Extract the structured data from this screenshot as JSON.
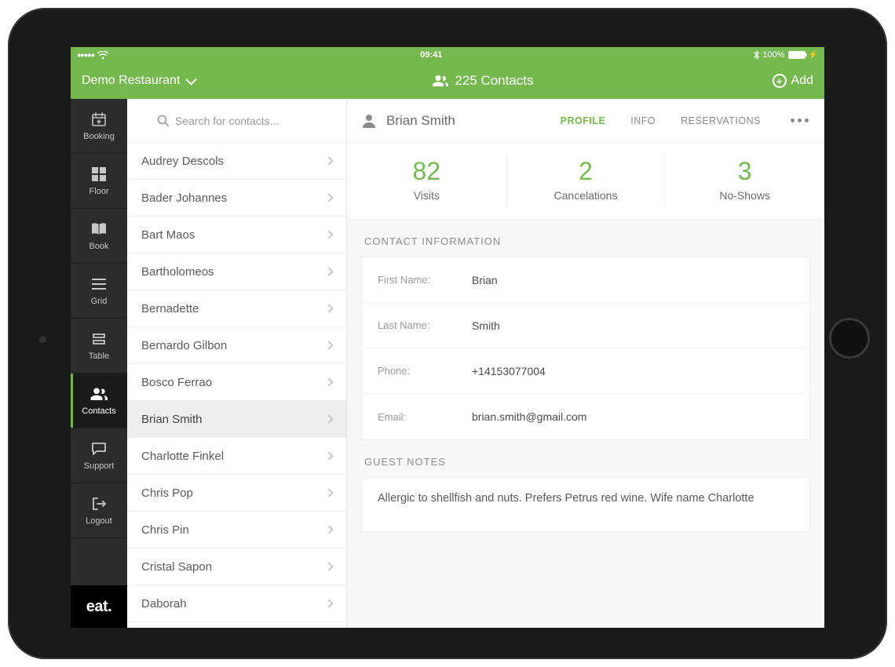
{
  "status": {
    "time": "09:41",
    "battery_text": "100%"
  },
  "header": {
    "restaurant_name": "Demo Restaurant",
    "contacts_count": "225 Contacts",
    "add_label": "Add"
  },
  "sidebar": {
    "items": [
      {
        "label": "Booking",
        "icon": "calendar-add-icon"
      },
      {
        "label": "Floor",
        "icon": "grid-squares-icon"
      },
      {
        "label": "Book",
        "icon": "book-icon"
      },
      {
        "label": "Grid",
        "icon": "lines-icon"
      },
      {
        "label": "Table",
        "icon": "table-icon"
      },
      {
        "label": "Contacts",
        "icon": "people-icon"
      },
      {
        "label": "Support",
        "icon": "chat-icon"
      },
      {
        "label": "Logout",
        "icon": "logout-icon"
      }
    ],
    "brand": "eat."
  },
  "search": {
    "placeholder": "Search for contacts..."
  },
  "contacts": [
    {
      "name": "Audrey Descols"
    },
    {
      "name": "Bader Johannes"
    },
    {
      "name": "Bart Maos"
    },
    {
      "name": "Bartholomeos"
    },
    {
      "name": "Bernadette"
    },
    {
      "name": "Bernardo Gilbon"
    },
    {
      "name": "Bosco Ferrao"
    },
    {
      "name": "Brian Smith",
      "selected": true
    },
    {
      "name": "Charlotte Finkel"
    },
    {
      "name": "Chris Pop"
    },
    {
      "name": "Chris Pin"
    },
    {
      "name": "Cristal Sapon"
    },
    {
      "name": "Daborah"
    }
  ],
  "detail": {
    "name": "Brian Smith",
    "tabs": {
      "profile": "PROFILE",
      "info": "INFO",
      "reservations": "RESERVATIONS"
    },
    "stats": {
      "visits": {
        "value": "82",
        "label": "Visits"
      },
      "cancelations": {
        "value": "2",
        "label": "Cancelations"
      },
      "noshows": {
        "value": "3",
        "label": "No-Shows"
      }
    },
    "section_contact": "CONTACT INFORMATION",
    "fields": {
      "first_name_label": "First Name:",
      "first_name": "Brian",
      "last_name_label": "Last Name:",
      "last_name": "Smith",
      "phone_label": "Phone:",
      "phone": "+14153077004",
      "email_label": "Email:",
      "email": "brian.smith@gmail.com"
    },
    "section_notes": "GUEST NOTES",
    "notes": "Allergic to shellfish and nuts. Prefers Petrus red wine. Wife name Charlotte"
  }
}
